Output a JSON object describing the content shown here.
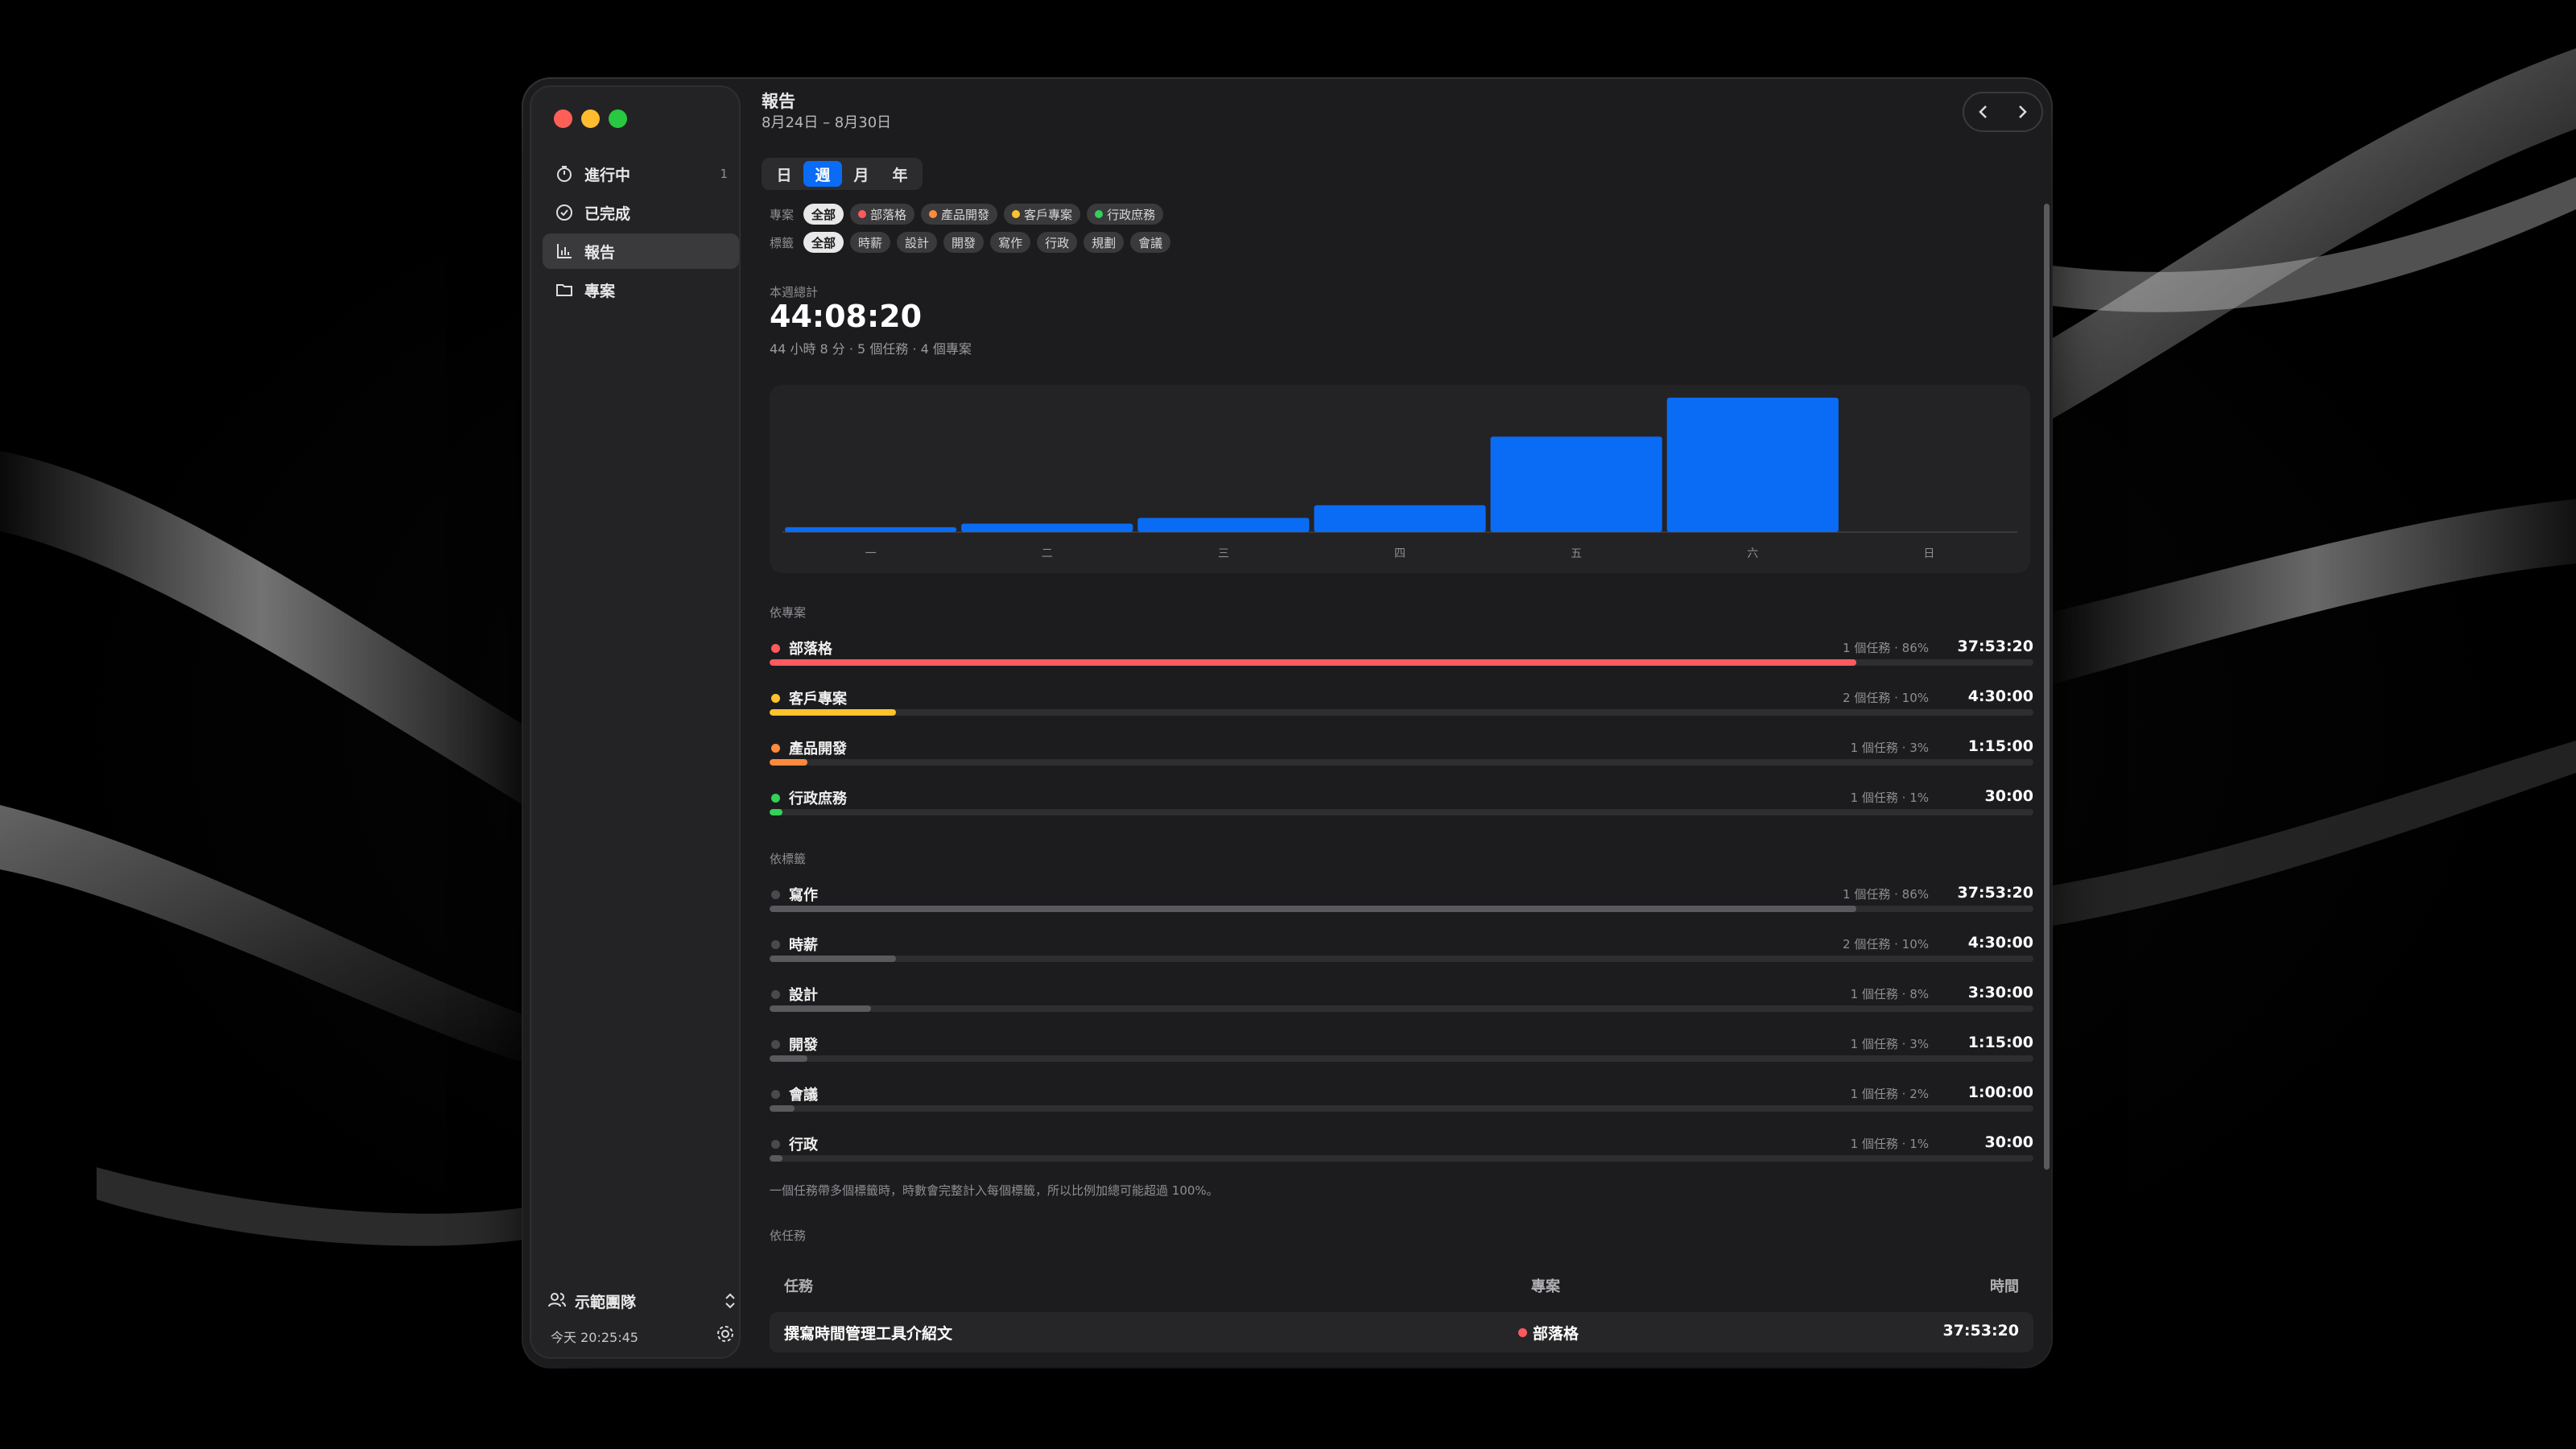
{
  "colors": {
    "accent": "#0a6cf5",
    "project_blog": "#ff5a5f",
    "project_client": "#ffc22e",
    "project_product": "#ff8a3d",
    "project_admin": "#34d058",
    "tag_bar": "#5a5a5e"
  },
  "sidebar": {
    "items": [
      {
        "label": "進行中",
        "icon": "timer-icon",
        "count": "1"
      },
      {
        "label": "已完成",
        "icon": "check-circle-icon",
        "count": ""
      },
      {
        "label": "報告",
        "icon": "bar-chart-icon",
        "count": ""
      },
      {
        "label": "專案",
        "icon": "folder-icon",
        "count": ""
      }
    ],
    "team": "示範團隊",
    "clock": "今天 20:25:45"
  },
  "header": {
    "title": "報告",
    "subtitle": "8月24日 – 8月30日"
  },
  "period_tabs": [
    {
      "label": "日",
      "selected": false
    },
    {
      "label": "週",
      "selected": true
    },
    {
      "label": "月",
      "selected": false
    },
    {
      "label": "年",
      "selected": false
    }
  ],
  "filters": {
    "project_label": "專案",
    "projects": [
      "全部",
      "部落格",
      "產品開發",
      "客戶專案",
      "行政庶務"
    ],
    "tag_label": "標籤",
    "tags": [
      "全部",
      "時薪",
      "設計",
      "開發",
      "寫作",
      "行政",
      "規劃",
      "會議"
    ]
  },
  "summary": {
    "label": "本週總計",
    "total": "44:08:20",
    "detail": "44 小時 8 分 · 5 個任務 · 4 個專案"
  },
  "chart_data": {
    "type": "bar",
    "categories": [
      "一",
      "二",
      "三",
      "四",
      "五",
      "六",
      "日"
    ],
    "values": [
      0.7,
      1.2,
      2.0,
      3.8,
      13.5,
      19.0,
      0
    ],
    "ylim": [
      0,
      19.0
    ],
    "color": "#0a6cf5",
    "grid": false
  },
  "by_project": {
    "label": "依專案",
    "rows": [
      {
        "name": "部落格",
        "meta": "1 個任務 · 86%",
        "time": "37:53:20",
        "pct": 86
      },
      {
        "name": "客戶專案",
        "meta": "2 個任務 · 10%",
        "time": "4:30:00",
        "pct": 10
      },
      {
        "name": "產品開發",
        "meta": "1 個任務 · 3%",
        "time": "1:15:00",
        "pct": 3
      },
      {
        "name": "行政庶務",
        "meta": "1 個任務 · 1%",
        "time": "30:00",
        "pct": 1
      }
    ]
  },
  "by_tag": {
    "label": "依標籤",
    "rows": [
      {
        "name": "寫作",
        "meta": "1 個任務 · 86%",
        "time": "37:53:20",
        "pct": 86
      },
      {
        "name": "時薪",
        "meta": "2 個任務 · 10%",
        "time": "4:30:00",
        "pct": 10
      },
      {
        "name": "設計",
        "meta": "1 個任務 · 8%",
        "time": "3:30:00",
        "pct": 8
      },
      {
        "name": "開發",
        "meta": "1 個任務 · 3%",
        "time": "1:15:00",
        "pct": 3
      },
      {
        "name": "會議",
        "meta": "1 個任務 · 2%",
        "time": "1:00:00",
        "pct": 2
      },
      {
        "name": "行政",
        "meta": "1 個任務 · 1%",
        "time": "30:00",
        "pct": 1
      }
    ],
    "note": "一個任務帶多個標籤時，時數會完整計入每個標籤，所以比例加總可能超過 100%。"
  },
  "by_task": {
    "label": "依任務",
    "columns": [
      "任務",
      "專案",
      "時間"
    ],
    "rows": [
      {
        "task": "撰寫時間管理工具介紹文",
        "project": "部落格",
        "time": "37:53:20"
      }
    ]
  }
}
